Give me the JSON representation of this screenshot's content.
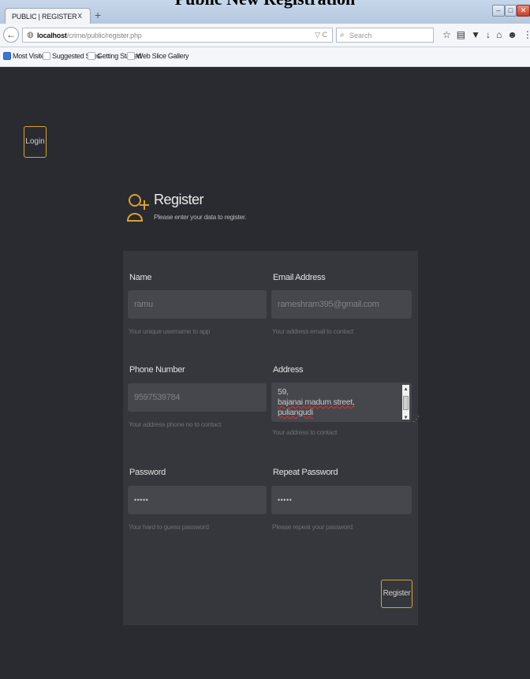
{
  "caption": "Public New Registration",
  "browser": {
    "tab_title": "PUBLIC | REGISTER",
    "tab_close": "x",
    "new_tab": "+",
    "url_host": "localhost",
    "url_path": "/crime/public/register.php",
    "url_icons": "▽ C",
    "search_placeholder": "Search",
    "bookmarks": [
      "Most Visited",
      "Suggested Sites",
      "Getting Started",
      "Web Slice Gallery"
    ]
  },
  "page": {
    "login_label": "Login",
    "title": "Register",
    "subtitle": "Please enter your data to register.",
    "accent_color": "#d9a134",
    "form": {
      "name": {
        "label": "Name",
        "value": "ramu",
        "help": "Your unique username to app"
      },
      "email": {
        "label": "Email Address",
        "value": "rameshram395@gmail.com",
        "help": "Your address email to contact"
      },
      "phone": {
        "label": "Phone Number",
        "value": "9597539784",
        "help": "Your address phone no to contact"
      },
      "address": {
        "label": "Address",
        "lines": [
          "59,",
          "bajanai madum street,",
          "puliangudi"
        ],
        "help": "Your address to contact"
      },
      "password": {
        "label": "Password",
        "value": "•••••",
        "help": "Your hard to guess password"
      },
      "repeat_password": {
        "label": "Repeat Password",
        "value": "•••••",
        "help": "Please repeat your password"
      },
      "submit_label": "Register"
    }
  }
}
